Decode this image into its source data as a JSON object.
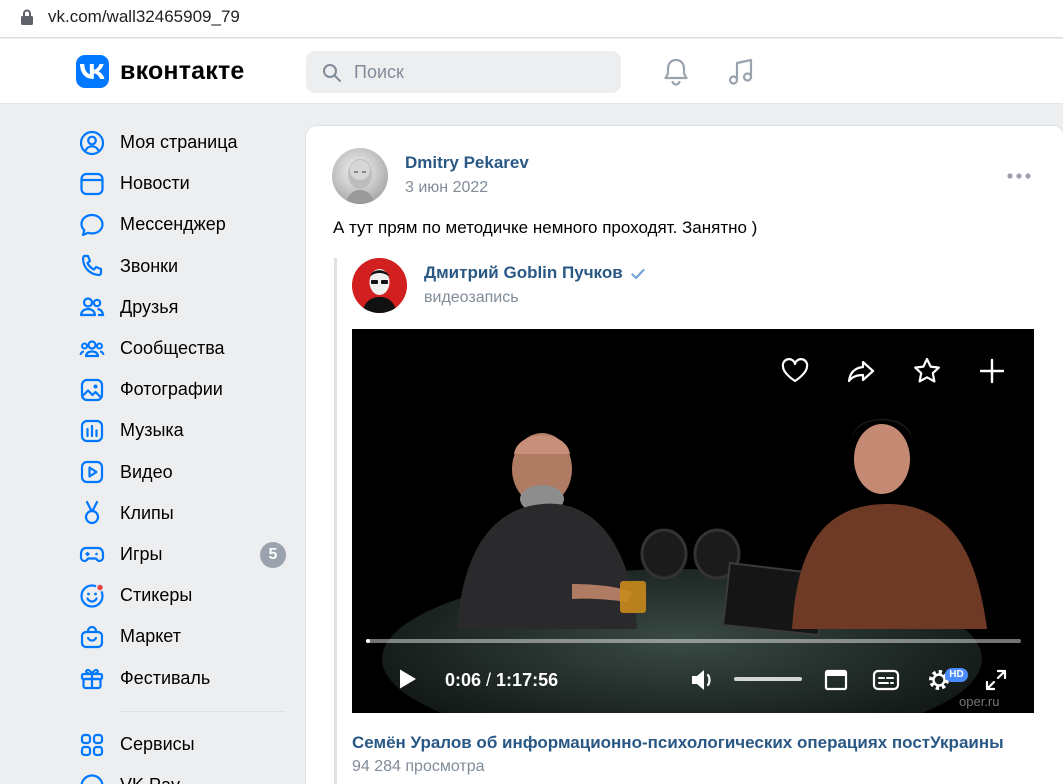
{
  "browser": {
    "url": "vk.com/wall32465909_79"
  },
  "header": {
    "logo_text": "вконтакте",
    "search_placeholder": "Поиск"
  },
  "sidebar": {
    "items": [
      {
        "label": "Моя страница",
        "icon": "user-circle-icon"
      },
      {
        "label": "Новости",
        "icon": "news-icon"
      },
      {
        "label": "Мессенджер",
        "icon": "message-icon"
      },
      {
        "label": "Звонки",
        "icon": "phone-icon"
      },
      {
        "label": "Друзья",
        "icon": "friends-icon"
      },
      {
        "label": "Сообщества",
        "icon": "communities-icon"
      },
      {
        "label": "Фотографии",
        "icon": "photo-icon"
      },
      {
        "label": "Музыка",
        "icon": "music-icon"
      },
      {
        "label": "Видео",
        "icon": "video-icon"
      },
      {
        "label": "Клипы",
        "icon": "clips-icon"
      },
      {
        "label": "Игры",
        "icon": "gamepad-icon",
        "badge": "5"
      },
      {
        "label": "Стикеры",
        "icon": "smile-icon"
      },
      {
        "label": "Маркет",
        "icon": "market-icon"
      },
      {
        "label": "Фестиваль",
        "icon": "gift-icon"
      }
    ],
    "services": [
      {
        "label": "Сервисы",
        "icon": "services-icon"
      },
      {
        "label": "VK Pay",
        "icon": "vkpay-icon"
      }
    ]
  },
  "post": {
    "author": "Dmitry Pekarev",
    "date": "3 июн 2022",
    "text": "А тут прям по методичке немного проходят. Занятно )",
    "repost": {
      "author": "Дмитрий Goblin Пучков",
      "type": "видеозапись",
      "video": {
        "current_time": "0:06",
        "duration": "1:17:56",
        "progress": 0.0013,
        "hd": "HD",
        "watermark": "oper.ru",
        "title": "Семён Уралов об информационно-психологических операциях постУкраины",
        "views": "94 284 просмотра"
      }
    }
  },
  "colors": {
    "accent": "#0077ff",
    "link": "#2a5885",
    "muted": "#818c99",
    "bg": "#edeef0"
  }
}
